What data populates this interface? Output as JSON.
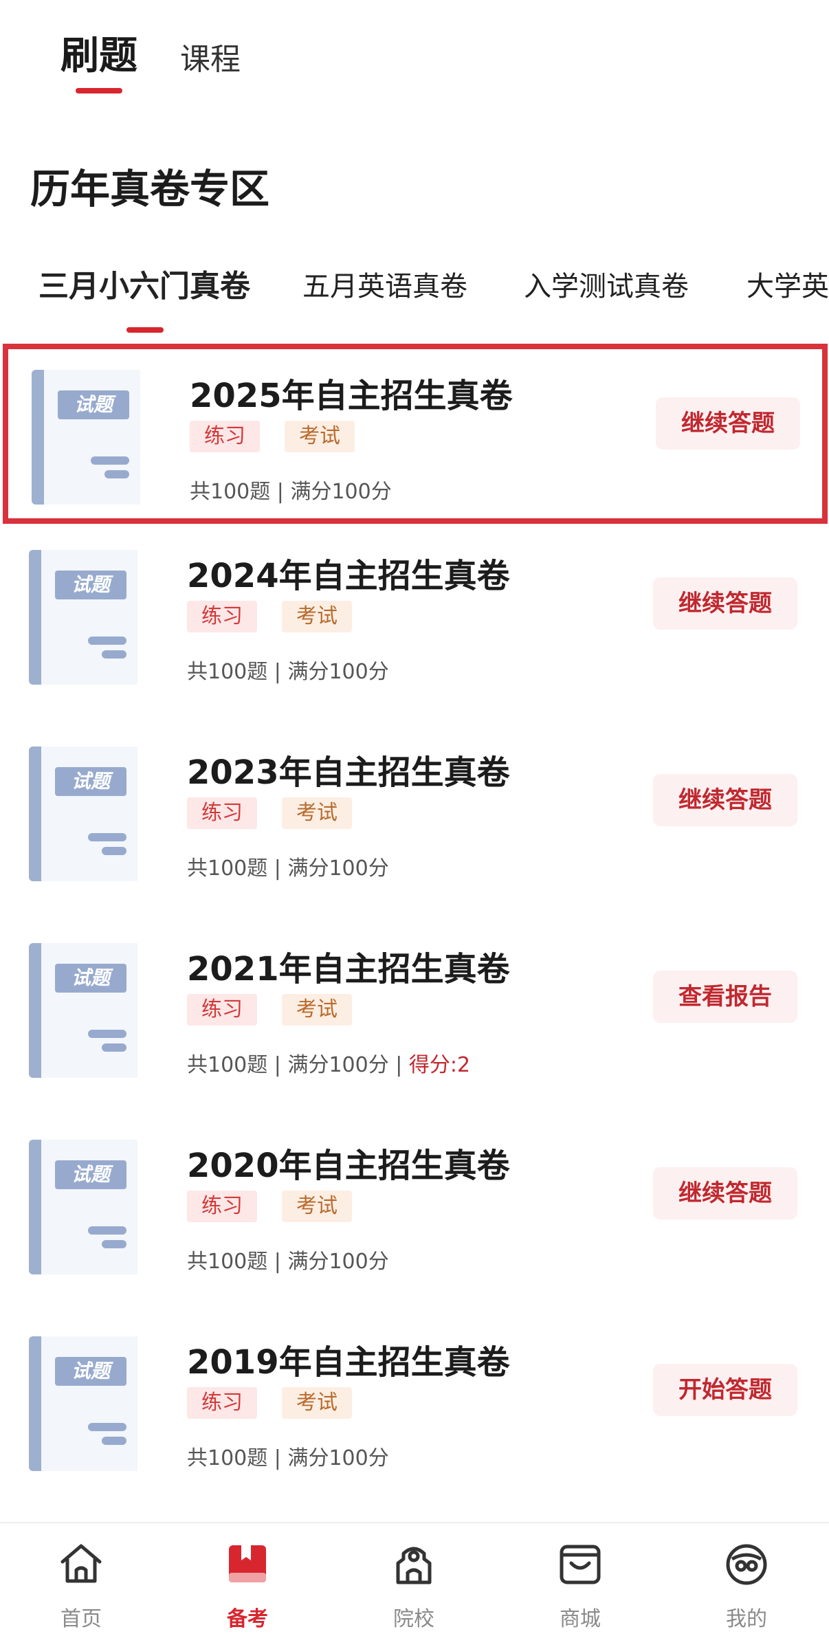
{
  "top_tabs": [
    {
      "label": "刷题",
      "active": true
    },
    {
      "label": "课程",
      "active": false
    }
  ],
  "section_title": "历年真卷专区",
  "category_tabs": [
    {
      "label": "三月小六门真卷",
      "active": true
    },
    {
      "label": "五月英语真卷",
      "active": false
    },
    {
      "label": "入学测试真卷",
      "active": false
    },
    {
      "label": "大学英",
      "active": false
    }
  ],
  "thumbnail_label": "试题",
  "papers": [
    {
      "title": "2025年自主招生真卷",
      "tag_practice": "练习",
      "tag_exam": "考试",
      "meta": "共100题 | 满分100分",
      "score": "",
      "action": "继续答题",
      "highlighted": true
    },
    {
      "title": "2024年自主招生真卷",
      "tag_practice": "练习",
      "tag_exam": "考试",
      "meta": "共100题 | 满分100分",
      "score": "",
      "action": "继续答题",
      "highlighted": false
    },
    {
      "title": "2023年自主招生真卷",
      "tag_practice": "练习",
      "tag_exam": "考试",
      "meta": "共100题 | 满分100分",
      "score": "",
      "action": "继续答题",
      "highlighted": false
    },
    {
      "title": "2021年自主招生真卷",
      "tag_practice": "练习",
      "tag_exam": "考试",
      "meta": "共100题 | 满分100分 | ",
      "score": "得分:2",
      "action": "查看报告",
      "highlighted": false
    },
    {
      "title": "2020年自主招生真卷",
      "tag_practice": "练习",
      "tag_exam": "考试",
      "meta": "共100题 | 满分100分",
      "score": "",
      "action": "继续答题",
      "highlighted": false
    },
    {
      "title": "2019年自主招生真卷",
      "tag_practice": "练习",
      "tag_exam": "考试",
      "meta": "共100题 | 满分100分",
      "score": "",
      "action": "开始答题",
      "highlighted": false
    }
  ],
  "bottom_nav": [
    {
      "label": "首页",
      "icon": "home-icon",
      "active": false
    },
    {
      "label": "备考",
      "icon": "book-icon",
      "active": true
    },
    {
      "label": "院校",
      "icon": "school-icon",
      "active": false
    },
    {
      "label": "商城",
      "icon": "shop-icon",
      "active": false
    },
    {
      "label": "我的",
      "icon": "profile-icon",
      "active": false
    }
  ],
  "colors": {
    "accent": "#d8262f",
    "tag_practice_bg": "#fde7e7",
    "tag_exam_bg": "#fdeee3",
    "thumb": "#97aace"
  }
}
